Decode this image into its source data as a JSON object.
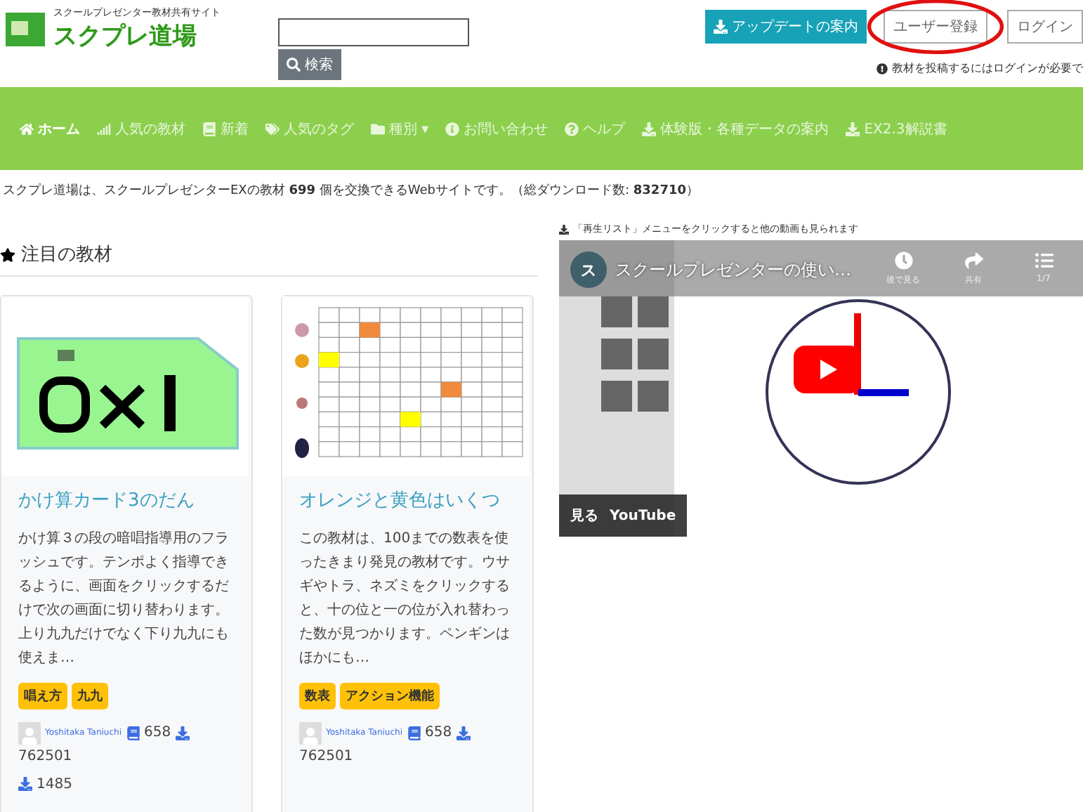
{
  "header": {
    "tagline": "スクールプレゼンター教材共有サイト",
    "logo_text": "スクプレ道場",
    "search": {
      "button": "検索"
    },
    "update_button": "アップデートの案内",
    "register_button": "ユーザー登録",
    "login_button": "ログイン",
    "notice": "教材を投稿するにはログインが必要で"
  },
  "nav": [
    {
      "label": "ホーム",
      "selected": true
    },
    {
      "label": "人気の教材",
      "selected": false
    },
    {
      "label": "新着",
      "selected": false
    },
    {
      "label": "人気のタグ",
      "selected": false
    },
    {
      "label": "種別",
      "selected": false,
      "caret": "▾"
    },
    {
      "label": "お問い合わせ",
      "selected": false
    },
    {
      "label": "ヘルプ",
      "selected": false
    },
    {
      "label": "体験版・各種データの案内",
      "selected": false
    },
    {
      "label": "EX2.3解説書",
      "selected": false
    }
  ],
  "intro": "スクプレ道場は、スクールプレゼンターEXの教材 **699** 個を交換できるWebサイトです。（総ダウンロード数: **832710**）",
  "featured": {
    "title": "注目の教材",
    "cards": [
      {
        "kind": "flash",
        "title": "かけ算カード3のだん",
        "description": "かけ算３の段の暗唱指導用のフラッシュです。テンポよく指導できるように、画面をクリックするだけで次の画面に切り替わります。上り九九だけでなく下り九九にも使えま…",
        "tags": [
          "唱え方",
          "九九"
        ],
        "author": "Yoshitaka Taniuchi",
        "count": "658",
        "downloads": "762501",
        "likes": "1485"
      },
      {
        "kind": "grid",
        "title": "オレンジと黄色はいくつ",
        "description": "この教材は、100までの数表を使ったきまり発見の教材です。ウサギやトラ、ネズミをクリックすると、十の位と一の位が入れ替わった数が見つかります。ペンギンはほかにも…",
        "tags": [
          "数表",
          "アクション機能"
        ],
        "author": "Yoshitaka Taniuchi",
        "count": "658",
        "downloads": "762501"
      }
    ]
  },
  "video": {
    "note": "「再生リスト」メニューをクリックすると他の動画も見られます",
    "channel_initial": "ス",
    "title": "スクールプレゼンターの使い…",
    "actions": [
      {
        "label": "後で見る"
      },
      {
        "label": "共有"
      },
      {
        "label": "1/7"
      }
    ],
    "watch_label": "見る",
    "youtube_label": "YouTube"
  }
}
